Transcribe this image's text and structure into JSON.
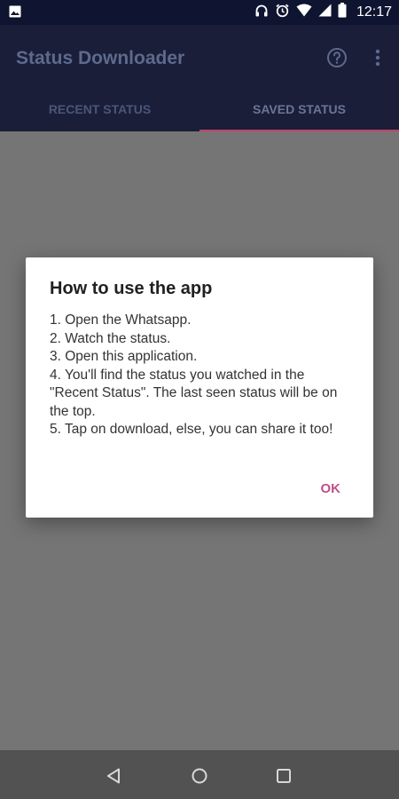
{
  "status_bar": {
    "time": "12:17",
    "icons": [
      "image-icon",
      "headphones-icon",
      "alarm-icon",
      "wifi-icon",
      "signal-icon",
      "battery-icon"
    ]
  },
  "app_bar": {
    "title": "Status Downloader",
    "actions": [
      "help-icon",
      "more-vert-icon"
    ],
    "tabs": [
      {
        "label": "RECENT STATUS",
        "selected": false
      },
      {
        "label": "SAVED STATUS",
        "selected": true
      }
    ],
    "indicator_color": "#c0436a"
  },
  "dialog": {
    "title": "How to use the app",
    "lines": [
      "1. Open the Whatsapp.",
      "2. Watch the status.",
      "3. Open this application.",
      "4. You'll find the status you watched in the \"Recent Status\". The last seen status will be on the top.",
      "5. Tap on download, else, you can share it too!"
    ],
    "ok_label": "OK",
    "accent_color": "#c0508a"
  },
  "nav_bar": {
    "buttons": [
      "back-icon",
      "home-icon",
      "recents-icon"
    ]
  }
}
